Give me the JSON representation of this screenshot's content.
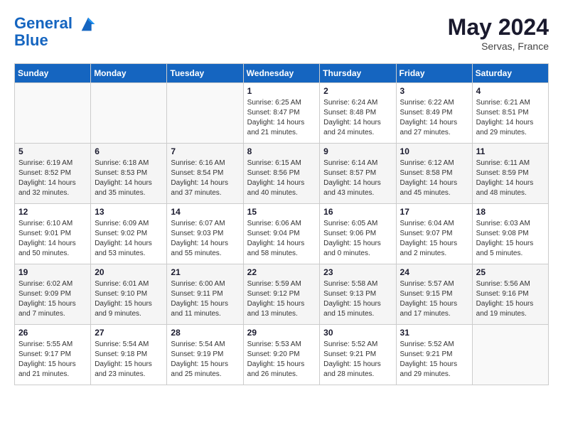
{
  "header": {
    "logo_line1": "General",
    "logo_line2": "Blue",
    "month_year": "May 2024",
    "location": "Servas, France"
  },
  "weekdays": [
    "Sunday",
    "Monday",
    "Tuesday",
    "Wednesday",
    "Thursday",
    "Friday",
    "Saturday"
  ],
  "weeks": [
    [
      {
        "day": "",
        "info": ""
      },
      {
        "day": "",
        "info": ""
      },
      {
        "day": "",
        "info": ""
      },
      {
        "day": "1",
        "info": "Sunrise: 6:25 AM\nSunset: 8:47 PM\nDaylight: 14 hours\nand 21 minutes."
      },
      {
        "day": "2",
        "info": "Sunrise: 6:24 AM\nSunset: 8:48 PM\nDaylight: 14 hours\nand 24 minutes."
      },
      {
        "day": "3",
        "info": "Sunrise: 6:22 AM\nSunset: 8:49 PM\nDaylight: 14 hours\nand 27 minutes."
      },
      {
        "day": "4",
        "info": "Sunrise: 6:21 AM\nSunset: 8:51 PM\nDaylight: 14 hours\nand 29 minutes."
      }
    ],
    [
      {
        "day": "5",
        "info": "Sunrise: 6:19 AM\nSunset: 8:52 PM\nDaylight: 14 hours\nand 32 minutes."
      },
      {
        "day": "6",
        "info": "Sunrise: 6:18 AM\nSunset: 8:53 PM\nDaylight: 14 hours\nand 35 minutes."
      },
      {
        "day": "7",
        "info": "Sunrise: 6:16 AM\nSunset: 8:54 PM\nDaylight: 14 hours\nand 37 minutes."
      },
      {
        "day": "8",
        "info": "Sunrise: 6:15 AM\nSunset: 8:56 PM\nDaylight: 14 hours\nand 40 minutes."
      },
      {
        "day": "9",
        "info": "Sunrise: 6:14 AM\nSunset: 8:57 PM\nDaylight: 14 hours\nand 43 minutes."
      },
      {
        "day": "10",
        "info": "Sunrise: 6:12 AM\nSunset: 8:58 PM\nDaylight: 14 hours\nand 45 minutes."
      },
      {
        "day": "11",
        "info": "Sunrise: 6:11 AM\nSunset: 8:59 PM\nDaylight: 14 hours\nand 48 minutes."
      }
    ],
    [
      {
        "day": "12",
        "info": "Sunrise: 6:10 AM\nSunset: 9:01 PM\nDaylight: 14 hours\nand 50 minutes."
      },
      {
        "day": "13",
        "info": "Sunrise: 6:09 AM\nSunset: 9:02 PM\nDaylight: 14 hours\nand 53 minutes."
      },
      {
        "day": "14",
        "info": "Sunrise: 6:07 AM\nSunset: 9:03 PM\nDaylight: 14 hours\nand 55 minutes."
      },
      {
        "day": "15",
        "info": "Sunrise: 6:06 AM\nSunset: 9:04 PM\nDaylight: 14 hours\nand 58 minutes."
      },
      {
        "day": "16",
        "info": "Sunrise: 6:05 AM\nSunset: 9:06 PM\nDaylight: 15 hours\nand 0 minutes."
      },
      {
        "day": "17",
        "info": "Sunrise: 6:04 AM\nSunset: 9:07 PM\nDaylight: 15 hours\nand 2 minutes."
      },
      {
        "day": "18",
        "info": "Sunrise: 6:03 AM\nSunset: 9:08 PM\nDaylight: 15 hours\nand 5 minutes."
      }
    ],
    [
      {
        "day": "19",
        "info": "Sunrise: 6:02 AM\nSunset: 9:09 PM\nDaylight: 15 hours\nand 7 minutes."
      },
      {
        "day": "20",
        "info": "Sunrise: 6:01 AM\nSunset: 9:10 PM\nDaylight: 15 hours\nand 9 minutes."
      },
      {
        "day": "21",
        "info": "Sunrise: 6:00 AM\nSunset: 9:11 PM\nDaylight: 15 hours\nand 11 minutes."
      },
      {
        "day": "22",
        "info": "Sunrise: 5:59 AM\nSunset: 9:12 PM\nDaylight: 15 hours\nand 13 minutes."
      },
      {
        "day": "23",
        "info": "Sunrise: 5:58 AM\nSunset: 9:13 PM\nDaylight: 15 hours\nand 15 minutes."
      },
      {
        "day": "24",
        "info": "Sunrise: 5:57 AM\nSunset: 9:15 PM\nDaylight: 15 hours\nand 17 minutes."
      },
      {
        "day": "25",
        "info": "Sunrise: 5:56 AM\nSunset: 9:16 PM\nDaylight: 15 hours\nand 19 minutes."
      }
    ],
    [
      {
        "day": "26",
        "info": "Sunrise: 5:55 AM\nSunset: 9:17 PM\nDaylight: 15 hours\nand 21 minutes."
      },
      {
        "day": "27",
        "info": "Sunrise: 5:54 AM\nSunset: 9:18 PM\nDaylight: 15 hours\nand 23 minutes."
      },
      {
        "day": "28",
        "info": "Sunrise: 5:54 AM\nSunset: 9:19 PM\nDaylight: 15 hours\nand 25 minutes."
      },
      {
        "day": "29",
        "info": "Sunrise: 5:53 AM\nSunset: 9:20 PM\nDaylight: 15 hours\nand 26 minutes."
      },
      {
        "day": "30",
        "info": "Sunrise: 5:52 AM\nSunset: 9:21 PM\nDaylight: 15 hours\nand 28 minutes."
      },
      {
        "day": "31",
        "info": "Sunrise: 5:52 AM\nSunset: 9:21 PM\nDaylight: 15 hours\nand 29 minutes."
      },
      {
        "day": "",
        "info": ""
      }
    ]
  ]
}
